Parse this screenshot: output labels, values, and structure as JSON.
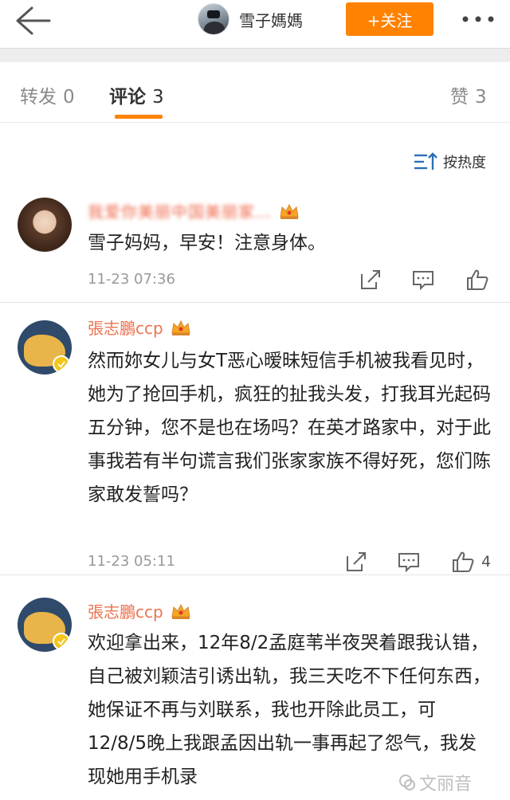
{
  "header": {
    "user_name": "雪子媽媽",
    "follow_label": "+关注"
  },
  "tabs": {
    "repost": {
      "label": "转发",
      "count": "0"
    },
    "comment": {
      "label": "评论",
      "count": "3"
    },
    "like": {
      "label": "赞",
      "count": "3"
    }
  },
  "sort": {
    "label": "按热度"
  },
  "comments": [
    {
      "name": "我爱你美丽中国美丽家…",
      "text": "雪子妈妈，早安！注意身体。",
      "time": "11-23 07:36",
      "likes": ""
    },
    {
      "name": "張志鵬ccp",
      "text": "然而妳女儿与女T恶心暧昧短信手机被我看见时，她为了抢回手机，疯狂的扯我头发，打我耳光起码五分钟，您不是也在场吗？在英才路家中，对于此事我若有半句谎言我们张家家族不得好死，您们陈家敢发誓吗？",
      "time": "11-23 05:11",
      "likes": "4"
    },
    {
      "name": "張志鵬ccp",
      "text": "欢迎拿出来，12年8/2孟庭苇半夜哭着跟我认错，自己被刘颖洁引诱出轨，我三天吃不下任何东西，她保证不再与刘联系，我也开除此员工，可12/8/5晚上我跟孟因出轨一事再起了怨气，我发现她用手机录",
      "time": "",
      "likes": ""
    }
  ],
  "watermark": "文丽音",
  "colors": {
    "accent": "#ff8200",
    "name": "#eb7350",
    "crown": "#f5a623"
  }
}
